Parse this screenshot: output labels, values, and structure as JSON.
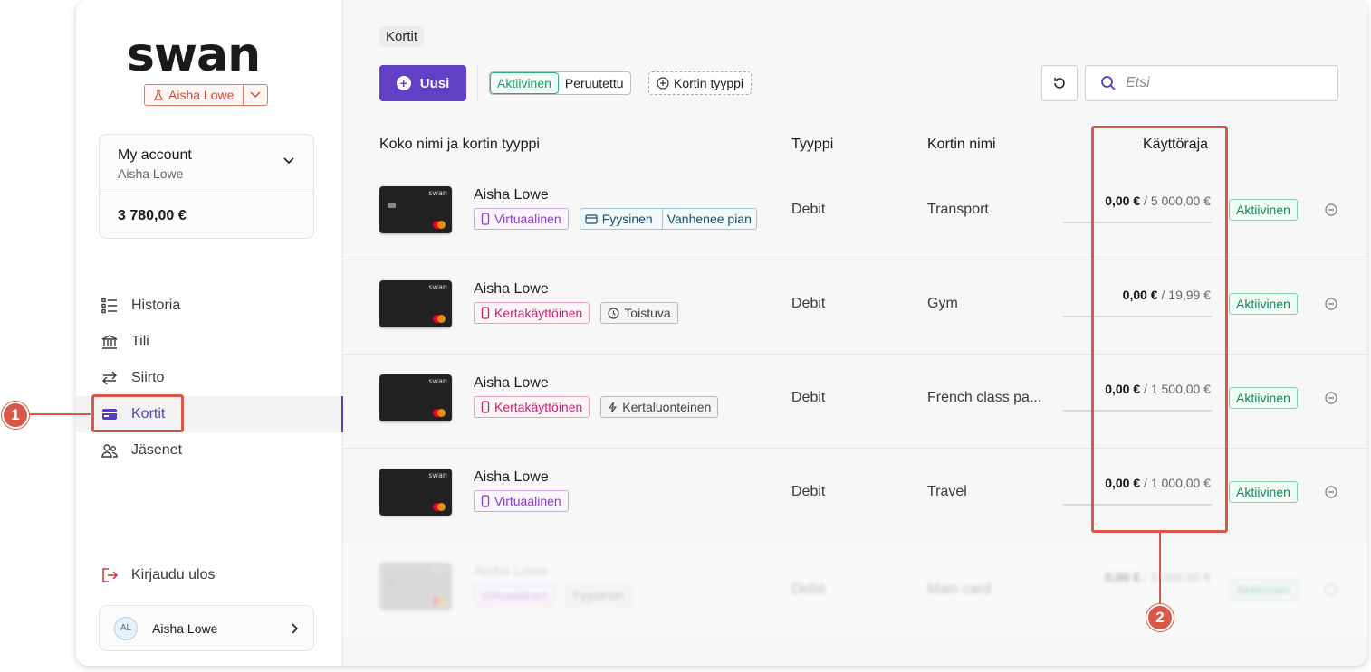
{
  "brand": {
    "logo_text": "swan",
    "project_name": "Aisha Lowe"
  },
  "account": {
    "title": "My account",
    "holder": "Aisha Lowe",
    "balance": "3 780,00 €"
  },
  "nav": {
    "items": [
      {
        "label": "Historia",
        "icon": "list-icon"
      },
      {
        "label": "Tili",
        "icon": "bank-icon"
      },
      {
        "label": "Siirto",
        "icon": "transfer-arrows-icon"
      },
      {
        "label": "Kortit",
        "icon": "card-icon",
        "active": true
      },
      {
        "label": "Jäsenet",
        "icon": "members-icon"
      }
    ],
    "logout_label": "Kirjaudu ulos"
  },
  "user": {
    "initials": "AL",
    "name": "Aisha Lowe"
  },
  "page": {
    "breadcrumb": "Kortit"
  },
  "toolbar": {
    "new_label": "Uusi",
    "filter_active": "Aktiivinen",
    "filter_cancelled": "Peruutettu",
    "type_filter_label": "Kortin tyyppi",
    "search_placeholder": "Etsi"
  },
  "table": {
    "headers": {
      "name": "Koko nimi ja kortin tyyppi",
      "type": "Tyyppi",
      "card_name": "Kortin nimi",
      "limit": "Käyttöraja"
    },
    "rows": [
      {
        "holder": "Aisha Lowe",
        "tags": [
          "Virtuaalinen",
          "Fyysinen",
          "Vanhenee pian"
        ],
        "type": "Debit",
        "card_name": "Transport",
        "spent": "0,00 €",
        "limit": "/ 5 000,00 €",
        "status": "Aktiivinen"
      },
      {
        "holder": "Aisha Lowe",
        "tags": [
          "Kertakäyttöinen",
          "Toistuva"
        ],
        "type": "Debit",
        "card_name": "Gym",
        "spent": "0,00 €",
        "limit": "/ 19,99 €",
        "status": "Aktiivinen"
      },
      {
        "holder": "Aisha Lowe",
        "tags": [
          "Kertakäyttöinen",
          "Kertaluonteinen"
        ],
        "type": "Debit",
        "card_name": "French class pa...",
        "spent": "0,00 €",
        "limit": "/ 1 500,00 €",
        "status": "Aktiivinen"
      },
      {
        "holder": "Aisha Lowe",
        "tags": [
          "Virtuaalinen"
        ],
        "type": "Debit",
        "card_name": "Travel",
        "spent": "0,00 €",
        "limit": "/ 1 000,00 €",
        "status": "Aktiivinen"
      },
      {
        "holder": "Aisha Lowe",
        "tags": [
          "Virtuaalinen",
          "Fyysinen"
        ],
        "type": "Debit",
        "card_name": "Main card",
        "spent": "0,00 €",
        "limit": "/ 5 000,00 €",
        "status": "Aktiivinen"
      }
    ]
  },
  "callouts": {
    "one": "1",
    "two": "2"
  },
  "colors": {
    "accent": "#6240c6",
    "callout": "#d9584a",
    "active_green": "#138a57"
  }
}
